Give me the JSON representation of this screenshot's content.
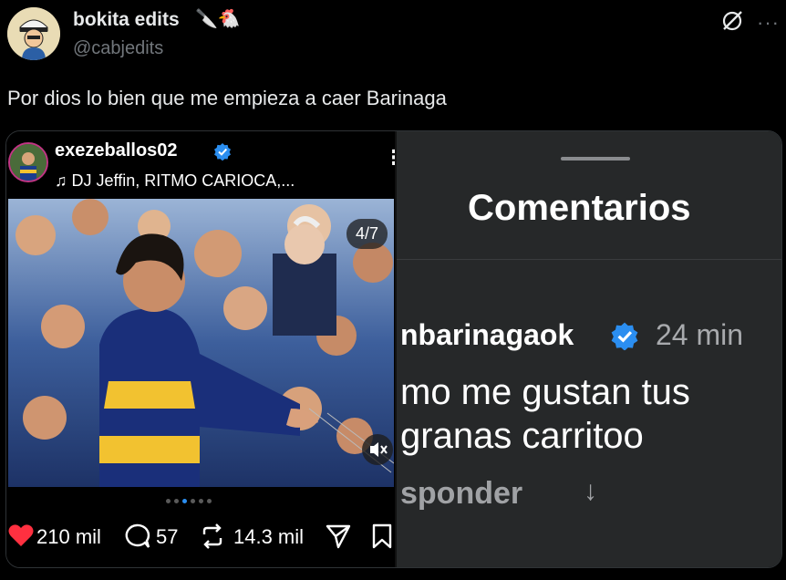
{
  "tweet": {
    "display_name": "bokita edits",
    "display_emojis": "🔪🐔",
    "handle": "@cabjedits",
    "text": "Por dios lo bien que me empieza a caer Barinaga",
    "grok_icon": "grok-slash-icon",
    "more_label": "···"
  },
  "instagram": {
    "username": "exezeballos02",
    "music": "♫ DJ Jeffin, RITMO CARIOCA,...",
    "more_glyph": "⋮",
    "counter": "4/7",
    "likes": "210 mil",
    "comments": "57",
    "reposts": "14.3 mil",
    "carousel_dots": 6,
    "carousel_active": 2
  },
  "comments_panel": {
    "title": "Comentarios",
    "commenter": "nbarinagaok",
    "time": "24 min",
    "text_line1": "mo me gustan tus",
    "text_line2": "granas carritoo",
    "reply": "sponder",
    "arrow": "↓"
  },
  "colors": {
    "background": "#000000",
    "text": "#e7e9ea",
    "secondary": "#71767b",
    "verified": "#2b8ef0",
    "like": "#ff3040",
    "panel": "#262829"
  }
}
